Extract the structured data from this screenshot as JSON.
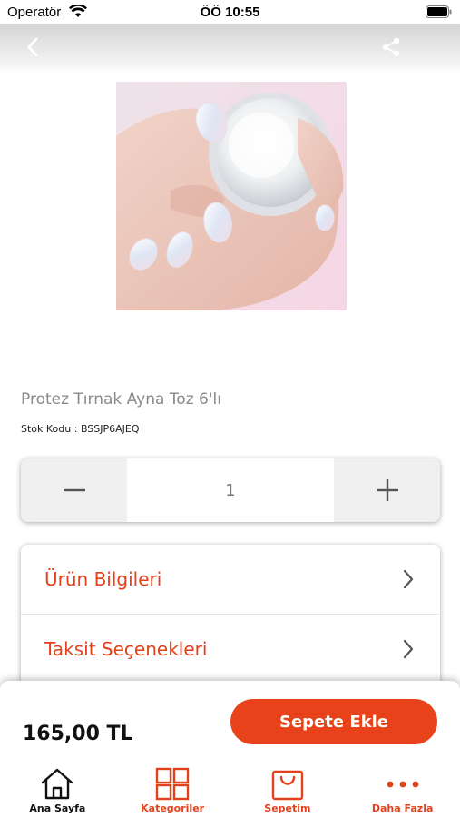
{
  "status_bar": {
    "carrier": "Operatör",
    "time": "ÖÖ 10:55"
  },
  "product": {
    "title": "Protez Tırnak Ayna Toz 6'lı",
    "stock_line": "Stok Kodu : BSSJP6AJEQ"
  },
  "stepper": {
    "quantity": "1"
  },
  "info_rows": [
    {
      "label": "Ürün Bilgileri"
    },
    {
      "label": "Taksit Seçenekleri"
    }
  ],
  "purchase": {
    "price": "165,00 TL",
    "add_to_cart_label": "Sepete Ekle"
  },
  "tabs": [
    {
      "label": "Ana Sayfa",
      "icon": "home-icon",
      "color": "#111111"
    },
    {
      "label": "Kategoriler",
      "icon": "grid-icon",
      "color": "#e2421b"
    },
    {
      "label": "Sepetim",
      "icon": "cart-icon",
      "color": "#e2421b"
    },
    {
      "label": "Daha Fazla",
      "icon": "more-dots-icon",
      "color": "#e2421b"
    }
  ],
  "colors": {
    "accent": "#e8421a",
    "label_orange": "#e2421b"
  }
}
